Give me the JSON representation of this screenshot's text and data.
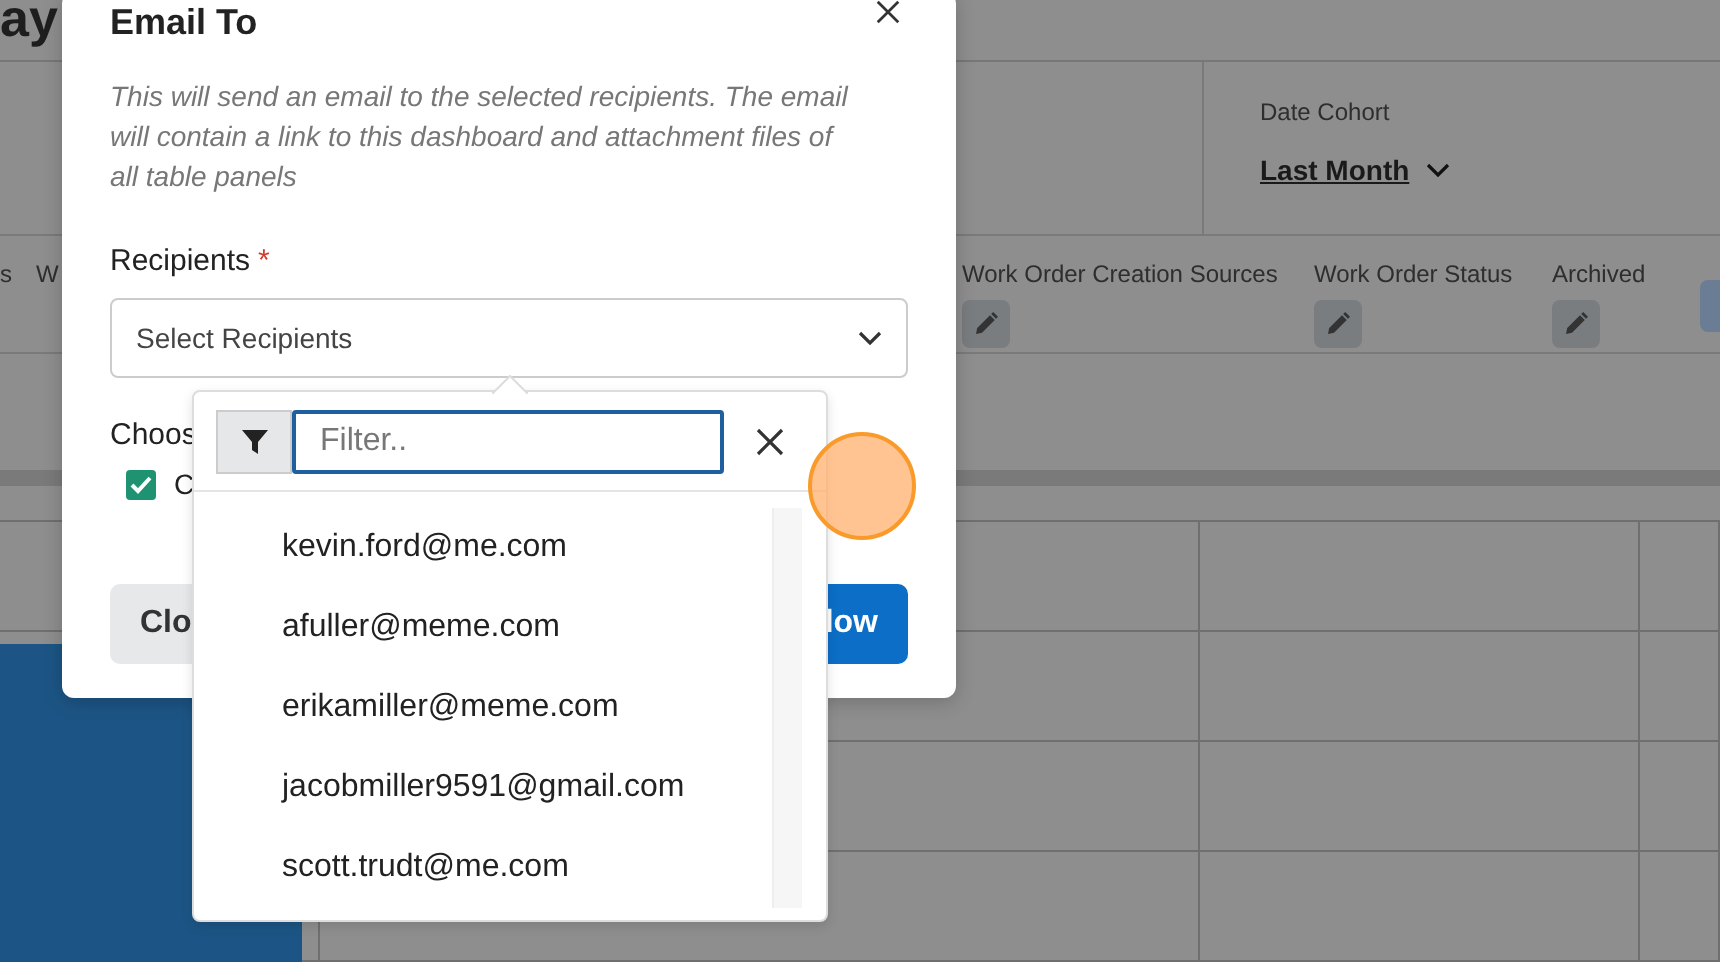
{
  "background": {
    "page_title": "ay",
    "date_cohort": {
      "label": "Date Cohort",
      "value": "Last Month"
    },
    "filters": [
      {
        "label": "s",
        "kind": "label-only"
      },
      {
        "label": "W",
        "kind": "label-only"
      },
      {
        "label": "Work Order Creation Sources",
        "kind": "with-edit"
      },
      {
        "label": "Work Order Status",
        "kind": "with-edit"
      },
      {
        "label": "Archived",
        "kind": "with-edit"
      }
    ]
  },
  "dialog": {
    "title": "Email To",
    "description": "This will send an email to the selected recipients. The email will contain a link to this dashboard and attachment files of all table panels",
    "recipients": {
      "label": "Recipients",
      "required_mark": "*",
      "placeholder": "Select Recipients"
    },
    "choose_label": "Choos",
    "options": [
      {
        "label": "C",
        "checked": true
      }
    ],
    "buttons": [
      {
        "label": "Clo",
        "kind": "secondary"
      },
      {
        "label": "low",
        "kind": "primary"
      }
    ]
  },
  "recipient_dropdown": {
    "filter_placeholder": "Filter..",
    "options": [
      "kevin.ford@me.com",
      "afuller@meme.com",
      "erikamiller@meme.com",
      "jacobmiller9591@gmail.com",
      "scott.trudt@me.com"
    ]
  }
}
